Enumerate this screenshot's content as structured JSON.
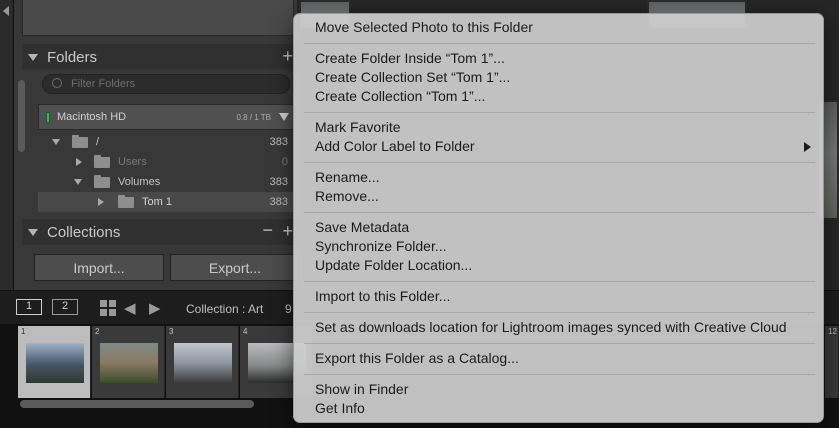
{
  "folders_panel": {
    "title": "Folders",
    "filter_placeholder": "Filter Folders",
    "volume": {
      "name": "Macintosh HD",
      "capacity": "0.8 / 1 TB"
    },
    "tree": [
      {
        "label": "/",
        "count": "383"
      },
      {
        "label": "Users",
        "count": "0"
      },
      {
        "label": "Volumes",
        "count": "383"
      },
      {
        "label": "Tom 1",
        "count": "383"
      }
    ]
  },
  "collections_panel": {
    "title": "Collections"
  },
  "buttons": {
    "import": "Import...",
    "export": "Export..."
  },
  "filmstrip_bar": {
    "view1": "1",
    "view2": "2",
    "collection_label": "Collection : Art",
    "count_partial": "9"
  },
  "filmstrip": {
    "cells": [
      "1",
      "2",
      "3",
      "4"
    ],
    "far_right_number": "12"
  },
  "context_menu": {
    "items": [
      "Move Selected Photo to this Folder",
      "Create Folder Inside “Tom 1”...",
      "Create Collection Set “Tom 1”...",
      "Create Collection “Tom 1”...",
      "Mark Favorite",
      "Add Color Label to Folder",
      "Rename...",
      "Remove...",
      "Save Metadata",
      "Synchronize Folder...",
      "Update Folder Location...",
      "Import to this Folder...",
      "Set as downloads location for Lightroom images synced with Creative Cloud",
      "Export this Folder as a Catalog...",
      "Show in Finder",
      "Get Info"
    ]
  },
  "colors": {
    "panel_bg": "#383838",
    "menu_bg": "#cdcdcd",
    "volume_led": "#3fb34f"
  }
}
